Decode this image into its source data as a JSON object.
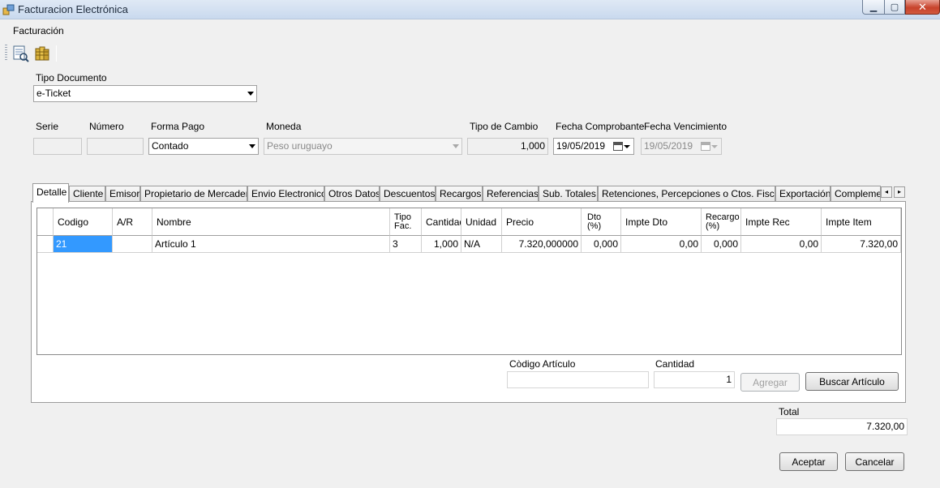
{
  "window": {
    "title": "Facturacion Electrónica"
  },
  "menu": {
    "facturacion": "Facturación"
  },
  "toolbar": {
    "icons": [
      "report-icon",
      "coins-icon"
    ]
  },
  "header": {
    "tipo_documento": {
      "label": "Tipo Documento",
      "value": "e-Ticket"
    },
    "serie": {
      "label": "Serie",
      "value": ""
    },
    "numero": {
      "label": "Número",
      "value": ""
    },
    "forma_pago": {
      "label": "Forma Pago",
      "value": "Contado"
    },
    "moneda": {
      "label": "Moneda",
      "value": "Peso uruguayo"
    },
    "tipo_cambio": {
      "label": "Tipo de Cambio",
      "value": "1,000"
    },
    "fecha_comprobante": {
      "label": "Fecha Comprobante",
      "value": "19/05/2019"
    },
    "fecha_vencimiento": {
      "label": "Fecha Vencimiento",
      "value": "19/05/2019"
    }
  },
  "tabs": [
    "Detalle",
    "Cliente",
    "Emisor",
    "Propietario de Mercadería",
    "Envio Electronico",
    "Otros Datos",
    "Descuentos",
    "Recargos",
    "Referencias",
    "Sub. Totales",
    "Retenciones, Percepciones o Ctos. Fiscales",
    "Exportación",
    "Complementos"
  ],
  "grid": {
    "columns": {
      "codigo": "Codigo",
      "ar": "A/R",
      "nombre": "Nombre",
      "tipo_fac_1": "Tipo",
      "tipo_fac_2": "Fac.",
      "cantidad": "Cantidad",
      "unidad": "Unidad",
      "precio": "Precio",
      "dto_1": "Dto",
      "dto_2": "(%)",
      "impte_dto": "Impte Dto",
      "recargo_1": "Recargo",
      "recargo_2": "(%)",
      "impte_rec": "Impte Rec",
      "impte_item": "Impte Item"
    },
    "rows": [
      {
        "codigo": "21",
        "ar": "",
        "nombre": "Artículo 1",
        "tipo_fac": "3",
        "cantidad": "1,000",
        "unidad": "N/A",
        "precio": "7.320,000000",
        "dto": "0,000",
        "impte_dto": "0,00",
        "recargo": "0,000",
        "impte_rec": "0,00",
        "impte_item": "7.320,00"
      }
    ]
  },
  "detalle_form": {
    "codigo_articulo_label": "Còdigo Artículo",
    "codigo_articulo_value": "",
    "cantidad_label": "Cantidad",
    "cantidad_value": "1",
    "agregar": "Agregar",
    "buscar": "Buscar Artículo"
  },
  "total": {
    "label": "Total",
    "value": "7.320,00"
  },
  "actions": {
    "aceptar": "Aceptar",
    "cancelar": "Cancelar"
  }
}
